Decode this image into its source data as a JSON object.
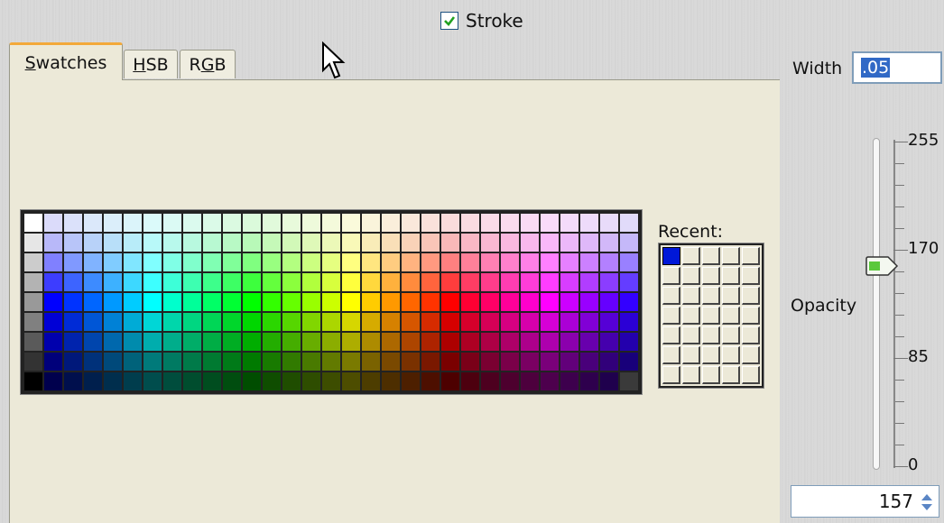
{
  "stroke": {
    "label": "Stroke",
    "checked": true
  },
  "tabs": [
    {
      "label": "Swatches",
      "underline": "S",
      "rest": "watches",
      "active": true
    },
    {
      "label": "HSB",
      "underline": "H",
      "rest": "SB",
      "active": false
    },
    {
      "label": "RGB",
      "underline": "G",
      "rest": "B",
      "pre": "R",
      "active": false
    }
  ],
  "width": {
    "label": "Width",
    "value": ".05"
  },
  "recent": {
    "label": "Recent:",
    "colors": [
      "#0018d8"
    ]
  },
  "opacity": {
    "label": "Opacity",
    "value": "157",
    "min": 0,
    "max": 255,
    "current": 157,
    "ticks": [
      "255",
      "170",
      "85",
      "0"
    ]
  },
  "colors": {
    "accent": "#f3a93a",
    "selection": "#3169c6",
    "panel": "#ece9d8"
  },
  "icons": {
    "checkbox": "check-icon",
    "cursor": "mouse-pointer-icon",
    "spinner": "spinner-arrows-icon",
    "thumb": "slider-thumb-icon"
  }
}
